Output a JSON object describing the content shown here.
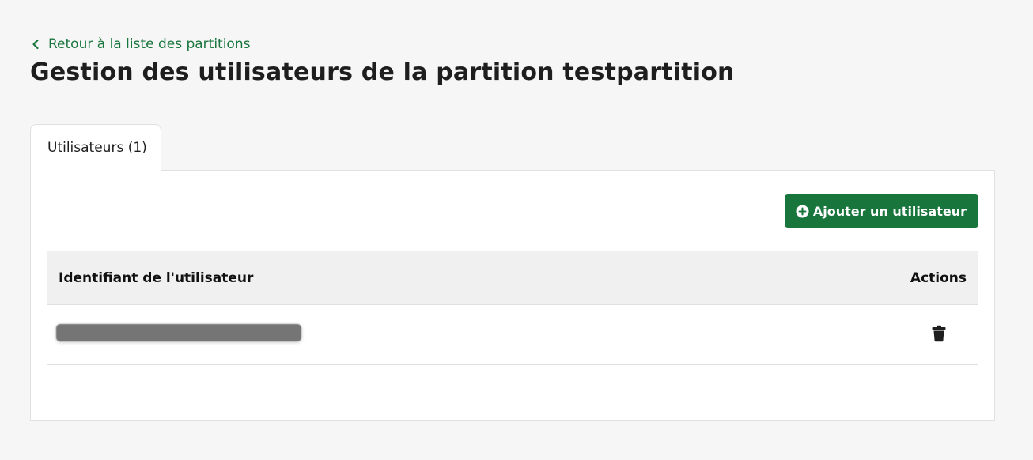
{
  "breadcrumb": {
    "back_label": "Retour à la liste des partitions"
  },
  "page": {
    "title": "Gestion des utilisateurs de la partition testpartition"
  },
  "tabs": [
    {
      "label": "Utilisateurs (1)",
      "active": true
    }
  ],
  "toolbar": {
    "add_user_label": "Ajouter un utilisateur"
  },
  "table": {
    "columns": [
      "Identifiant de l'utilisateur",
      "Actions"
    ],
    "rows": [
      {
        "user_id_redacted": true,
        "action_icon": "trash-icon"
      }
    ]
  },
  "icons": {
    "back": "chevron-left-icon",
    "add": "plus-circle-icon",
    "delete": "trash-icon"
  },
  "colors": {
    "accent": "#18753c",
    "background": "#f6f6f7",
    "table_header_bg": "#f0f0f1"
  }
}
